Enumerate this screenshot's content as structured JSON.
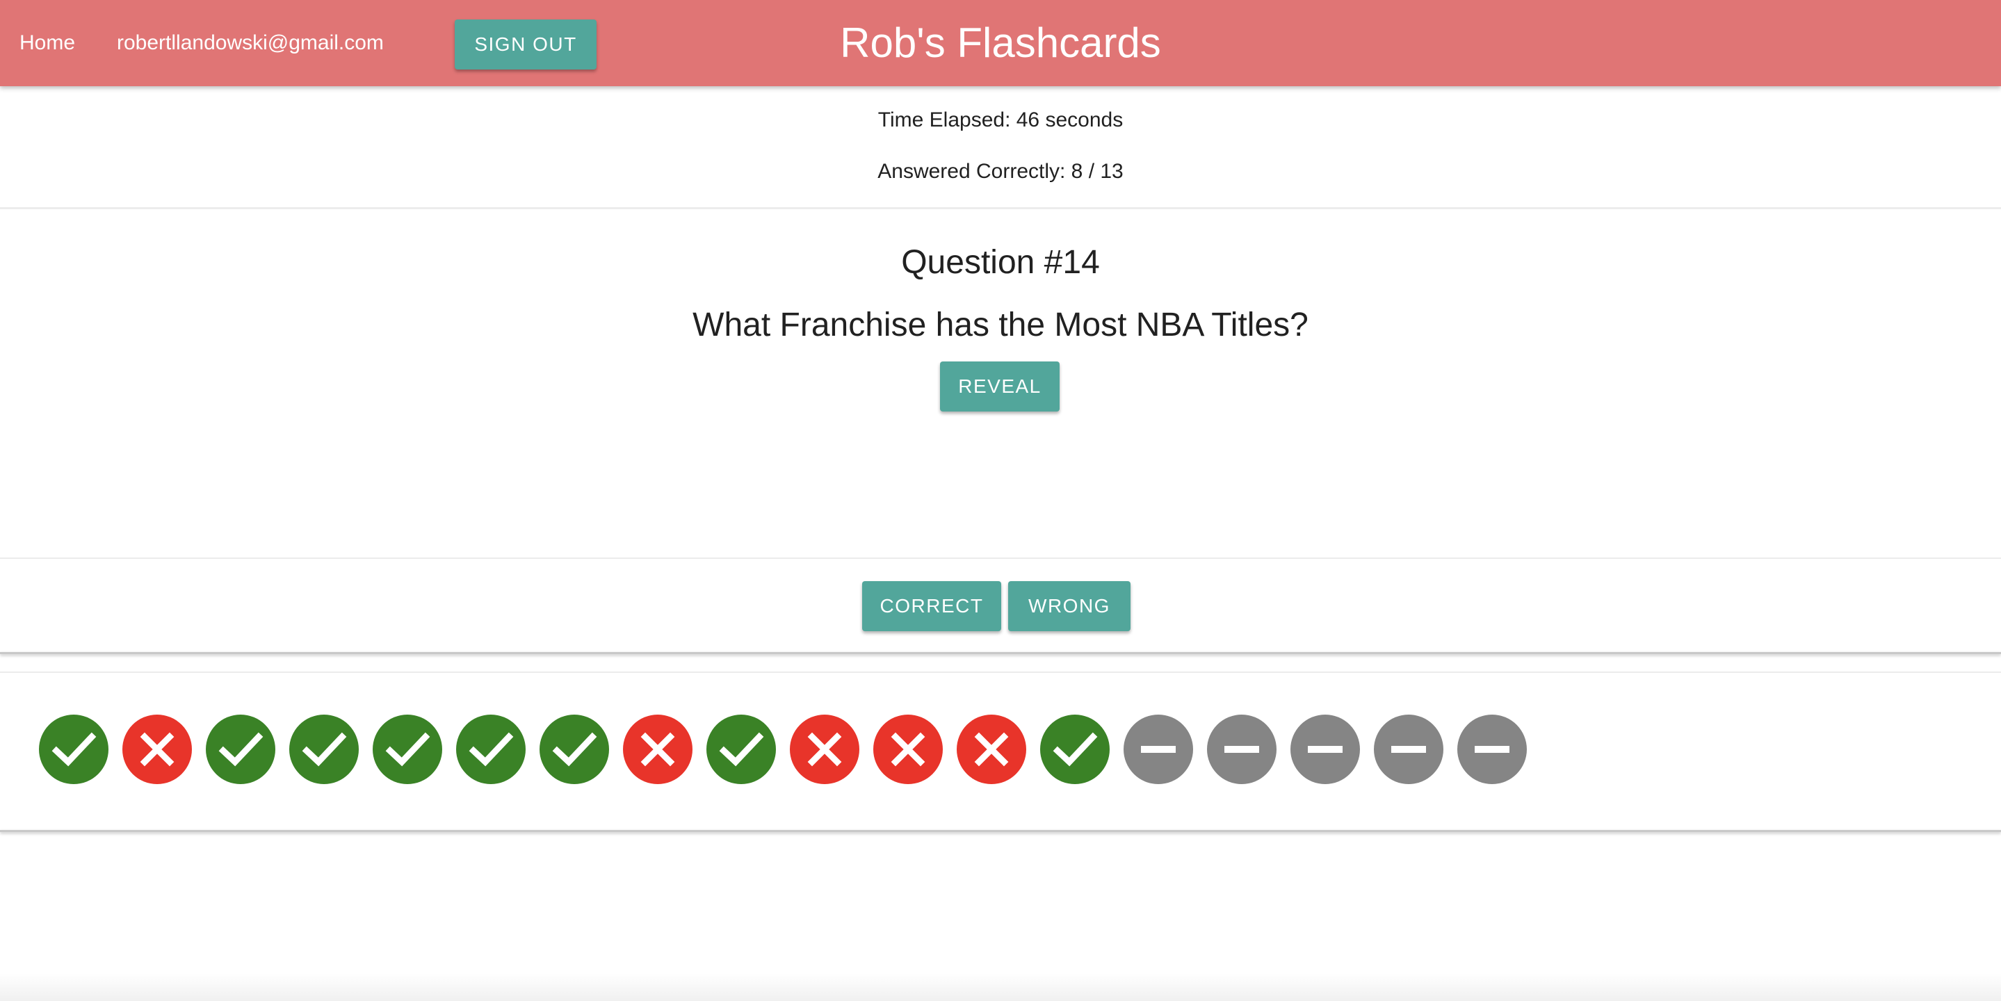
{
  "header": {
    "home_label": "Home",
    "user_email": "robertllandowski@gmail.com",
    "signout_label": "SIGN OUT",
    "title": "Rob's Flashcards"
  },
  "stats": {
    "time_elapsed": "Time Elapsed: 46 seconds",
    "answered_correctly": "Answered Correctly: 8 / 13"
  },
  "question": {
    "number_label": "Question #14",
    "text": "What Franchise has the Most NBA Titles?",
    "reveal_label": "REVEAL"
  },
  "grading": {
    "correct_label": "CORRECT",
    "wrong_label": "WRONG"
  },
  "progress": {
    "results": [
      "correct",
      "wrong",
      "correct",
      "correct",
      "correct",
      "correct",
      "correct",
      "wrong",
      "correct",
      "wrong",
      "wrong",
      "wrong",
      "correct",
      "pending",
      "pending",
      "pending",
      "pending",
      "pending"
    ]
  },
  "colors": {
    "app_bar": "#e07575",
    "button": "#52a69b",
    "correct": "#3a8226",
    "wrong": "#e8342a",
    "pending": "#858585"
  },
  "icons": {
    "correct": "check-icon",
    "wrong": "x-icon",
    "pending": "minus-icon"
  }
}
